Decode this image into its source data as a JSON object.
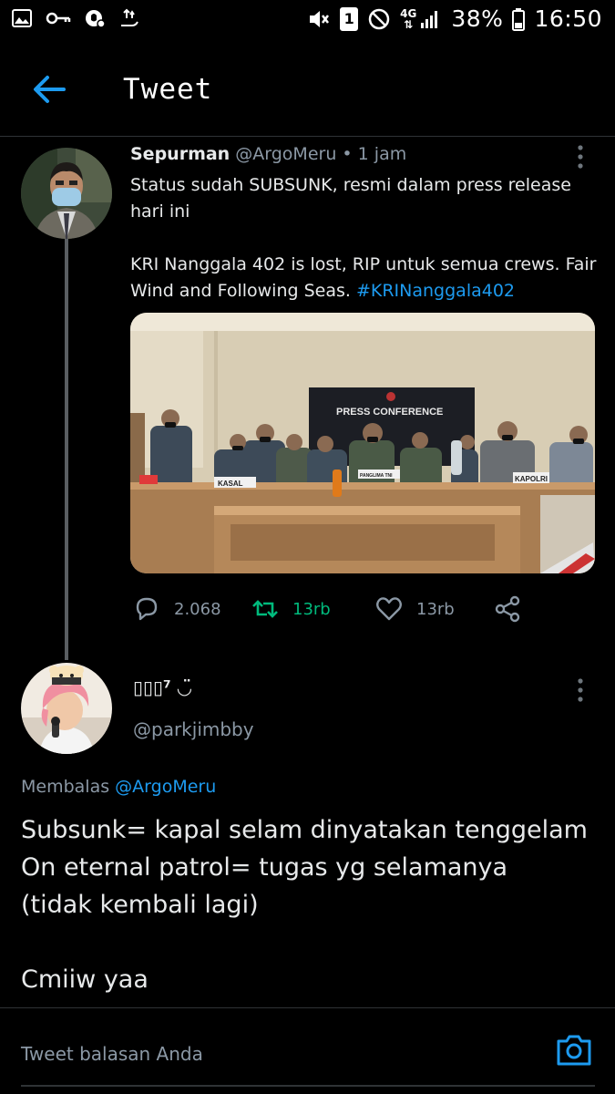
{
  "status_bar": {
    "battery": "38%",
    "time": "16:50",
    "sim_badge": "1",
    "network": "4G",
    "icons": [
      "gallery-icon",
      "key-icon",
      "shield-icon",
      "hand-upload-icon",
      "mute-icon",
      "dnd-icon",
      "signal-icon"
    ]
  },
  "header": {
    "title": "Tweet",
    "back_icon": "arrow-left-icon"
  },
  "tweet": {
    "author_name": "Sepurman",
    "handle": "@ArgoMeru",
    "separator": " • ",
    "time": "1 jam",
    "text_main": "Status sudah SUBSUNK, resmi dalam press release hari ini\n\nKRI Nanggala 402 is lost, RIP untuk semua crews. Fair Wind and Following Seas. ",
    "hashtag": "#KRINanggala402",
    "media": {
      "banner_text": "PRESS CONFERENCE",
      "placard_left": "KASAL",
      "placard_mid": "PANGLIMA TNI",
      "placard_right": "KAPOLRI"
    },
    "actions": {
      "reply_count": "2.068",
      "retweet_count": "13rb",
      "like_count": "13rb"
    }
  },
  "reply": {
    "author_name": "▯▯▯⁷ ◡̈",
    "handle": "@parkjimbby",
    "replying_label": "Membalas ",
    "replying_to": "@ArgoMeru",
    "text": "Subsunk= kapal selam dinyatakan tenggelam\nOn eternal patrol= tugas yg selamanya\n(tidak kembali lagi)\n\nCmiiw yaa"
  },
  "composer": {
    "placeholder": "Tweet balasan Anda"
  },
  "colors": {
    "background": "#000000",
    "accent": "#1d9bf0",
    "retweet": "#00ba7c",
    "muted": "#8b98a5",
    "divider": "#2f3336"
  }
}
